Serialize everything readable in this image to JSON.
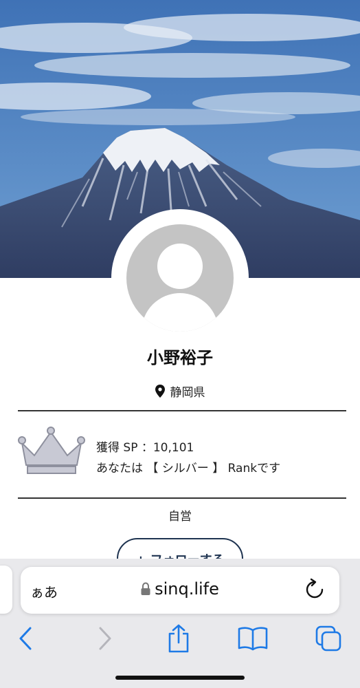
{
  "profile": {
    "name": "小野裕子",
    "location": "静岡県",
    "sp_line": "獲得 SP ：10,101",
    "rank_line": "あなたは 【 シルバー 】 Rankです",
    "occupation": "自営",
    "follow_label": "+ フォローする"
  },
  "browser": {
    "text_size_label": "ぁあ",
    "url": "sinq.life"
  },
  "icons": {
    "location": "map-pin-icon",
    "crown": "crown-icon",
    "lock": "lock-icon",
    "reload": "reload-icon",
    "back": "chevron-left-icon",
    "forward": "chevron-right-icon",
    "share": "share-icon",
    "bookmarks": "book-icon",
    "tabs": "tabs-icon"
  },
  "colors": {
    "accent": "#1e7ae6",
    "follow_border": "#1e3350",
    "crown_fill": "#c8c9d4",
    "avatar_gray": "#c4c4c4"
  }
}
